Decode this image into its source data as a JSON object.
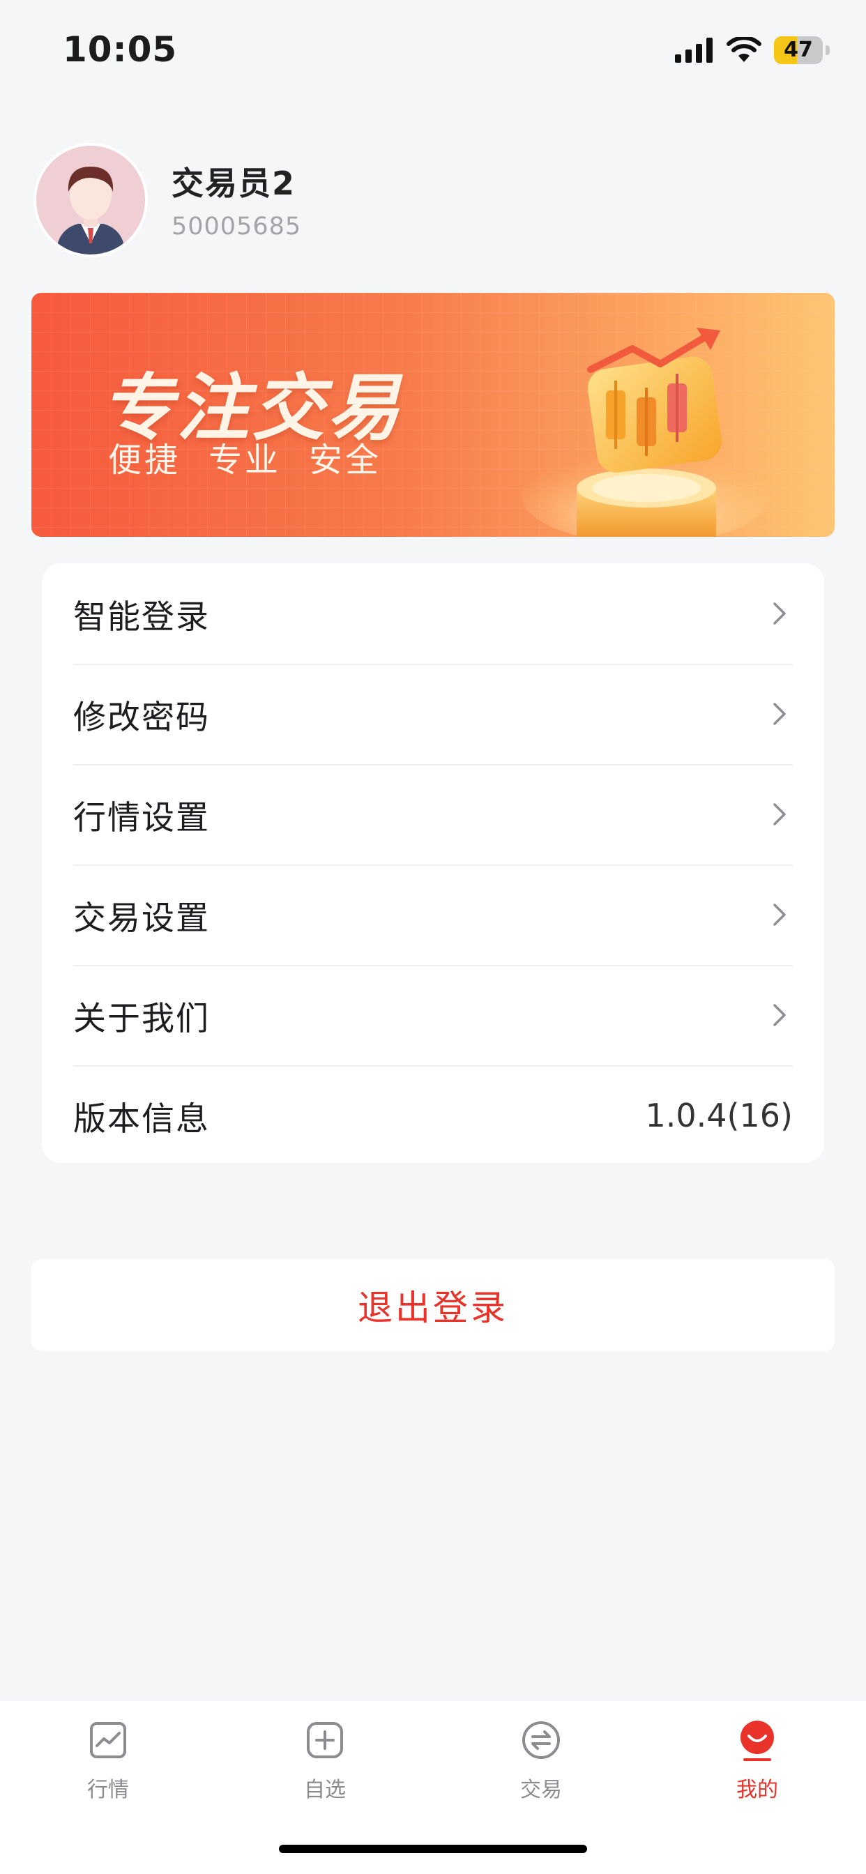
{
  "status_bar": {
    "time": "10:05",
    "battery_percent": 47,
    "battery_label": "47"
  },
  "profile": {
    "name": "交易员2",
    "account_id": "50005685"
  },
  "banner": {
    "title": "专注交易",
    "tags": [
      "便捷",
      "专业",
      "安全"
    ]
  },
  "menu": {
    "items": [
      {
        "label": "智能登录",
        "has_chevron": true
      },
      {
        "label": "修改密码",
        "has_chevron": true
      },
      {
        "label": "行情设置",
        "has_chevron": true
      },
      {
        "label": "交易设置",
        "has_chevron": true
      },
      {
        "label": "关于我们",
        "has_chevron": true
      },
      {
        "label": "版本信息",
        "value": "1.0.4(16)"
      }
    ]
  },
  "logout": {
    "label": "退出登录"
  },
  "tabbar": {
    "tabs": [
      {
        "label": "行情",
        "icon": "chart-icon",
        "active": false
      },
      {
        "label": "自选",
        "icon": "add-square-icon",
        "active": false
      },
      {
        "label": "交易",
        "icon": "exchange-icon",
        "active": false
      },
      {
        "label": "我的",
        "icon": "smile-icon",
        "active": true
      }
    ]
  },
  "colors": {
    "accent": "#e8322a",
    "background": "#f5f6f8",
    "battery": "#f5c518"
  }
}
